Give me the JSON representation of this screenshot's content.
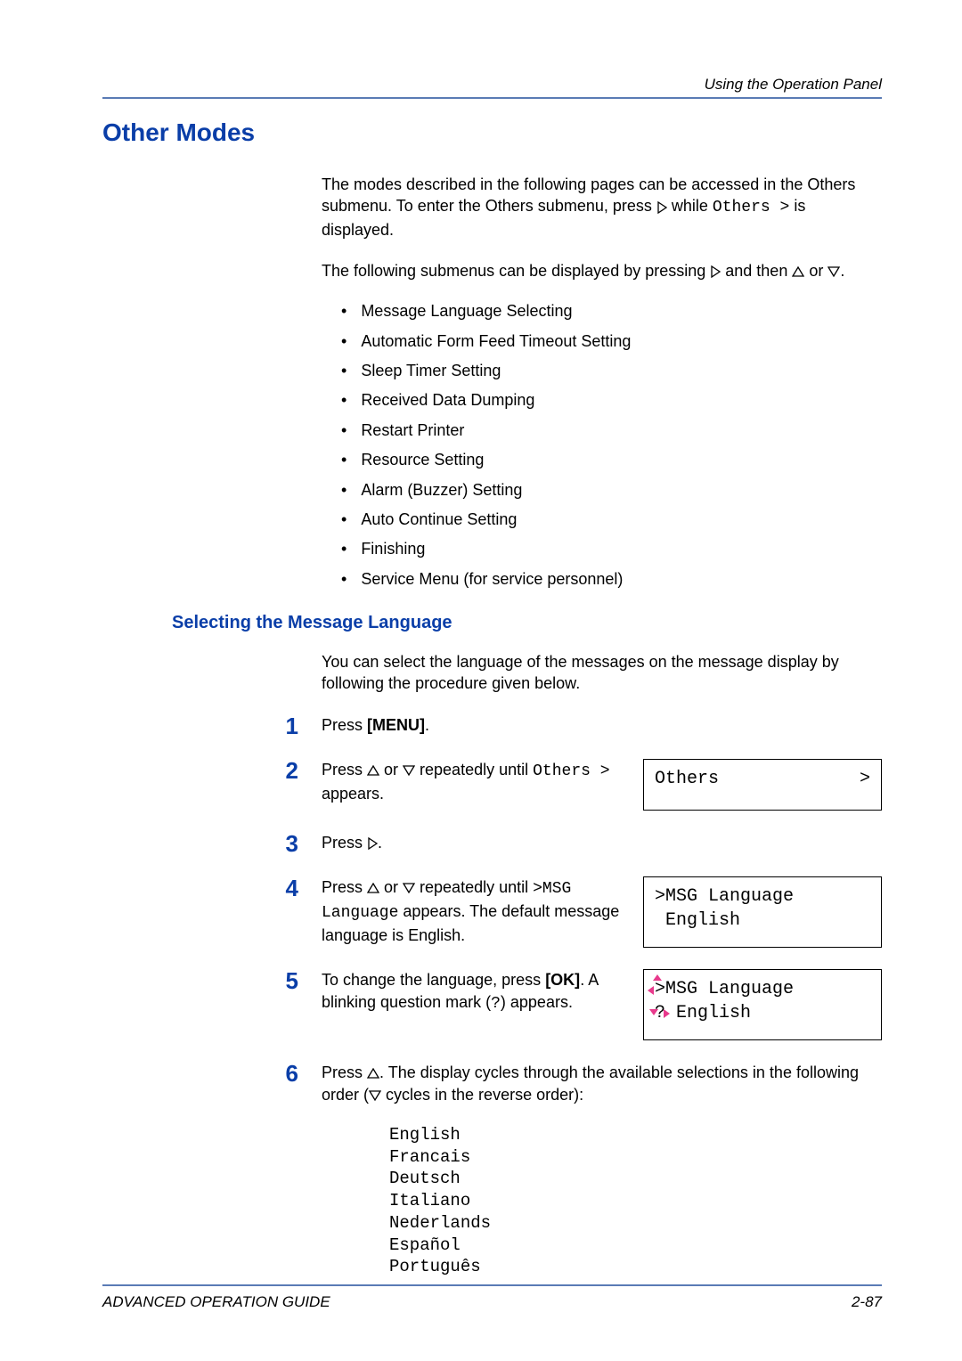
{
  "header": {
    "section_name": "Using the Operation Panel"
  },
  "title": "Other Modes",
  "intro": {
    "p1_a": "The modes described in the following pages can be accessed in the Others submenu. To enter the Others submenu, press ",
    "p1_b": " while ",
    "p1_mono": "Others >",
    "p1_c": " is displayed.",
    "p2_a": "The following submenus can be displayed by pressing ",
    "p2_b": " and then ",
    "p2_c": " or ",
    "p2_d": "."
  },
  "bullets": [
    "Message Language Selecting",
    "Automatic Form Feed Timeout Setting",
    "Sleep Timer Setting",
    "Received Data Dumping",
    "Restart Printer",
    "Resource Setting",
    "Alarm (Buzzer) Setting",
    "Auto Continue Setting",
    "Finishing",
    "Service Menu (for service personnel)"
  ],
  "subsection": {
    "title": "Selecting the Message Language",
    "intro": "You can select the language of the messages on the message display by following the procedure given below."
  },
  "steps": {
    "s1": {
      "num": "1",
      "a": "Press ",
      "bold": "[MENU]",
      "b": "."
    },
    "s2": {
      "num": "2",
      "a": "Press ",
      "b": " or ",
      "c": " repeatedly until ",
      "mono": "Others >",
      "d": " appears."
    },
    "s3": {
      "num": "3",
      "a": "Press ",
      "b": "."
    },
    "s4": {
      "num": "4",
      "a": "Press ",
      "b": " or ",
      "c": " repeatedly until ",
      "mono": ">MSG Language",
      "d": " appears. The default message language is English."
    },
    "s5": {
      "num": "5",
      "a": "To change the language, press ",
      "bold": "[OK]",
      "b": ". A blinking question mark (",
      "mono": "?",
      "c": ") appears."
    },
    "s6": {
      "num": "6",
      "a": "Press ",
      "b": ". The display cycles through the available selections in the following order (",
      "c": " cycles in the reverse order):"
    }
  },
  "displays": {
    "d2_l1_left": "Others",
    "d2_l1_right": ">",
    "d4_l1": ">MSG Language",
    "d4_l2": " English",
    "d5_l1": ">MSG Language",
    "d5_l2": "? English"
  },
  "languages": [
    "English",
    "Francais",
    "Deutsch",
    "Italiano",
    "Nederlands",
    "Español",
    "Português"
  ],
  "footer": {
    "left": "ADVANCED OPERATION GUIDE",
    "right": "2-87"
  }
}
